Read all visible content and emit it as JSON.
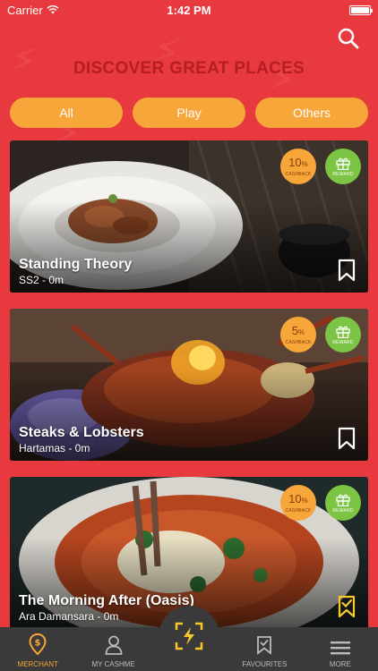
{
  "status_bar": {
    "carrier": "Carrier",
    "time": "1:42 PM"
  },
  "header": {
    "title": "DISCOVER GREAT PLACES",
    "search_icon": "search-icon"
  },
  "filters": [
    "All",
    "Play",
    "Others"
  ],
  "colors": {
    "background": "#E8393F",
    "title": "#B51E22",
    "accent": "#F7A63A",
    "reward": "#7CC444",
    "tabbar": "#3a3a3a"
  },
  "cards": [
    {
      "title": "Standing Theory",
      "subtitle": "SS2 -   0m",
      "cashback_value": "10",
      "cashback_unit": "%",
      "cashback_label": "CASHBACK",
      "reward_label": "REWARD",
      "bookmarked": false
    },
    {
      "title": "Steaks & Lobsters",
      "subtitle": "Hartamas -   0m",
      "cashback_value": "5",
      "cashback_unit": "%",
      "cashback_label": "CASHBACK",
      "reward_label": "REWARD",
      "bookmarked": false
    },
    {
      "title": "The Morning After (Oasis)",
      "subtitle": "Ara Damansara -   0m",
      "cashback_value": "10",
      "cashback_unit": "%",
      "cashback_label": "CASHBACK",
      "reward_label": "REWARD",
      "bookmarked": true
    }
  ],
  "tabbar": {
    "merchant": "MERCHANT",
    "my_cashme": "MY CASHME",
    "favourites": "FAVOURITES",
    "more": "MORE"
  }
}
